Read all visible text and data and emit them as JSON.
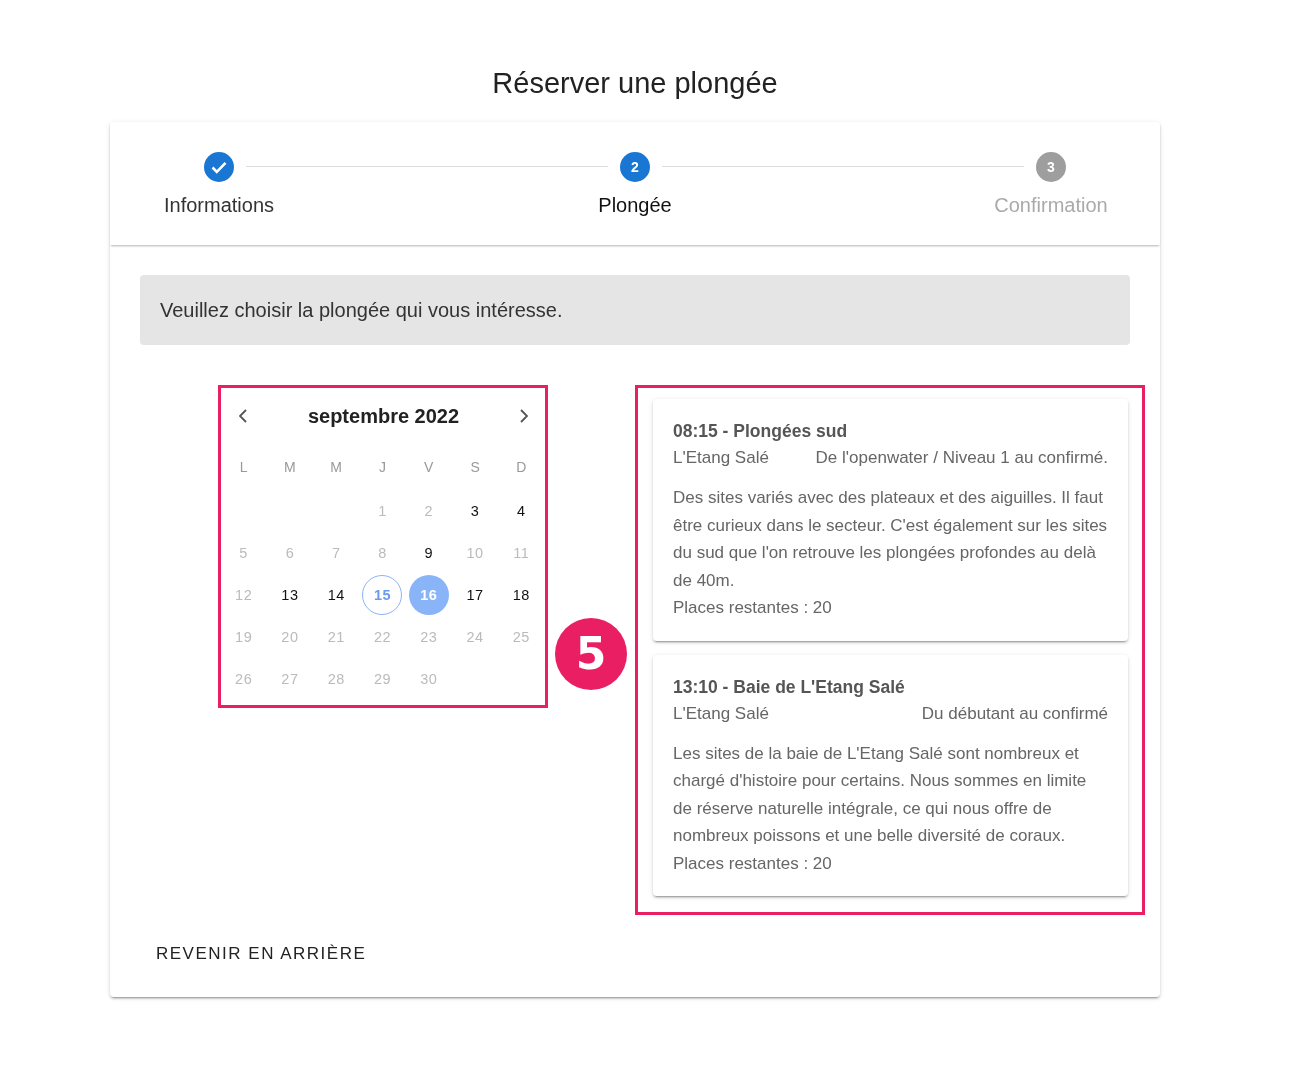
{
  "title": "Réserver une plongée",
  "steps": [
    {
      "label": "Informations",
      "completed": true,
      "selected": false
    },
    {
      "number": "2",
      "label": "Plongée",
      "completed": false,
      "selected": true
    },
    {
      "number": "3",
      "label": "Confirmation",
      "completed": false,
      "selected": false
    }
  ],
  "info_message": "Veuillez choisir la plongée qui vous intéresse.",
  "calendar": {
    "month": "septembre 2022",
    "weekdays": [
      "L",
      "M",
      "M",
      "J",
      "V",
      "S",
      "D"
    ],
    "weeks": [
      [
        {
          "day": "1",
          "disabled": true,
          "today": false,
          "selected": false
        },
        {
          "day": "2",
          "disabled": true,
          "today": false,
          "selected": false
        },
        {
          "day": "3",
          "disabled": false,
          "today": false,
          "selected": false
        },
        {
          "day": "4",
          "disabled": false,
          "today": false,
          "selected": false
        }
      ],
      [
        {
          "day": "5",
          "disabled": true,
          "today": false,
          "selected": false
        },
        {
          "day": "6",
          "disabled": true,
          "today": false,
          "selected": false
        },
        {
          "day": "7",
          "disabled": true,
          "today": false,
          "selected": false
        },
        {
          "day": "8",
          "disabled": true,
          "today": false,
          "selected": false
        },
        {
          "day": "9",
          "disabled": false,
          "today": false,
          "selected": false
        },
        {
          "day": "10",
          "disabled": true,
          "today": false,
          "selected": false
        },
        {
          "day": "11",
          "disabled": true,
          "today": false,
          "selected": false
        }
      ],
      [
        {
          "day": "12",
          "disabled": true,
          "today": false,
          "selected": false
        },
        {
          "day": "13",
          "disabled": false,
          "today": false,
          "selected": false
        },
        {
          "day": "14",
          "disabled": false,
          "today": false,
          "selected": false
        },
        {
          "day": "15",
          "disabled": false,
          "today": true,
          "selected": false
        },
        {
          "day": "16",
          "disabled": false,
          "today": false,
          "selected": true
        },
        {
          "day": "17",
          "disabled": false,
          "today": false,
          "selected": false
        },
        {
          "day": "18",
          "disabled": false,
          "today": false,
          "selected": false
        }
      ],
      [
        {
          "day": "19",
          "disabled": true,
          "today": false,
          "selected": false
        },
        {
          "day": "20",
          "disabled": true,
          "today": false,
          "selected": false
        },
        {
          "day": "21",
          "disabled": true,
          "today": false,
          "selected": false
        },
        {
          "day": "22",
          "disabled": true,
          "today": false,
          "selected": false
        },
        {
          "day": "23",
          "disabled": true,
          "today": false,
          "selected": false
        },
        {
          "day": "24",
          "disabled": true,
          "today": false,
          "selected": false
        },
        {
          "day": "25",
          "disabled": true,
          "today": false,
          "selected": false
        }
      ],
      [
        {
          "day": "26",
          "disabled": true,
          "today": false,
          "selected": false
        },
        {
          "day": "27",
          "disabled": true,
          "today": false,
          "selected": false
        },
        {
          "day": "28",
          "disabled": true,
          "today": false,
          "selected": false
        },
        {
          "day": "29",
          "disabled": true,
          "today": false,
          "selected": false
        },
        {
          "day": "30",
          "disabled": true,
          "today": false,
          "selected": false
        }
      ]
    ]
  },
  "callout": {
    "number": "5"
  },
  "dives": [
    {
      "title": "08:15 - Plongées sud",
      "location": "L'Etang Salé",
      "audience": "De l'openwater / Niveau 1 au confirmé.",
      "description": "Des sites variés avec des plateaux et des aiguilles. Il faut être curieux dans le secteur. C'est également sur les sites du sud que l'on retrouve les plongées profondes au delà de 40m.",
      "places": "Places restantes : 20"
    },
    {
      "title": "13:10 - Baie de L'Etang Salé",
      "location": "L'Etang Salé",
      "audience": "Du débutant au confirmé",
      "description": "Les sites de la baie de L'Etang Salé sont nombreux et chargé d'histoire pour certains. Nous sommes en limite de réserve naturelle intégrale, ce qui nous offre de nombreux poissons et une belle diversité de coraux.",
      "places": "Places restantes : 20"
    }
  ],
  "back_button": "REVENIR EN ARRIÈRE"
}
